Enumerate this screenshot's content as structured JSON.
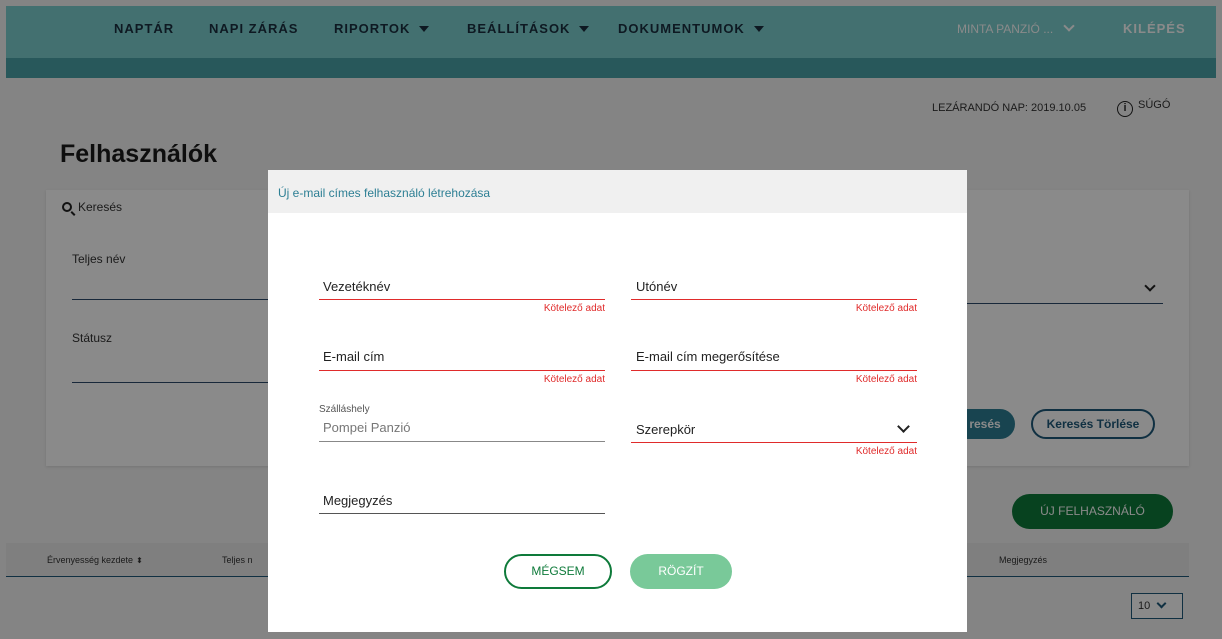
{
  "nav": {
    "items": [
      {
        "label": "NAPTÁR",
        "dropdown": false
      },
      {
        "label": "NAPI ZÁRÁS",
        "dropdown": false
      },
      {
        "label": "RIPORTOK",
        "dropdown": true
      },
      {
        "label": "BEÁLLÍTÁSOK",
        "dropdown": true
      },
      {
        "label": "DOKUMENTUMOK",
        "dropdown": true
      }
    ],
    "property_selector": "MINTA PANZIÓ ...",
    "logout": "KILÉPÉS"
  },
  "info": {
    "closing_day": "LEZÁRANDÓ NAP: 2019.10.05",
    "help": "SÚGÓ",
    "help_icon": "i"
  },
  "page": {
    "title": "Felhasználók"
  },
  "search": {
    "header": "Keresés",
    "full_name_label": "Teljes név",
    "status_label": "Státusz",
    "search_button": "resés",
    "clear_button": "Keresés Törlése"
  },
  "table": {
    "new_user_button": "ÚJ FELHASZNÁLÓ",
    "columns": [
      "Érvenyesség kezdete",
      "Teljes n",
      "Megjegyzés"
    ],
    "sort_icon": "⬍",
    "page_size": "10"
  },
  "modal": {
    "title": "Új e-mail címes felhasználó létrehozása",
    "last_name_label": "Vezetéknév",
    "first_name_label": "Utónév",
    "email_label": "E-mail cím",
    "email_confirm_label": "E-mail cím megerősítése",
    "accommodation_label": "Szálláshely",
    "accommodation_value": "Pompei Panzió",
    "role_label": "Szerepkör",
    "note_label": "Megjegyzés",
    "required_text": "Kötelező adat",
    "cancel_button": "MÉGSEM",
    "save_button": "RÖGZÍT"
  },
  "colors": {
    "nav_bg": "#7ccfcf",
    "nav_strip": "#4aa3a8",
    "accent_teal": "#2d7f94",
    "primary_green": "#0e7a3a",
    "disabled_green": "#79c999",
    "required_red": "#e02b2b"
  }
}
